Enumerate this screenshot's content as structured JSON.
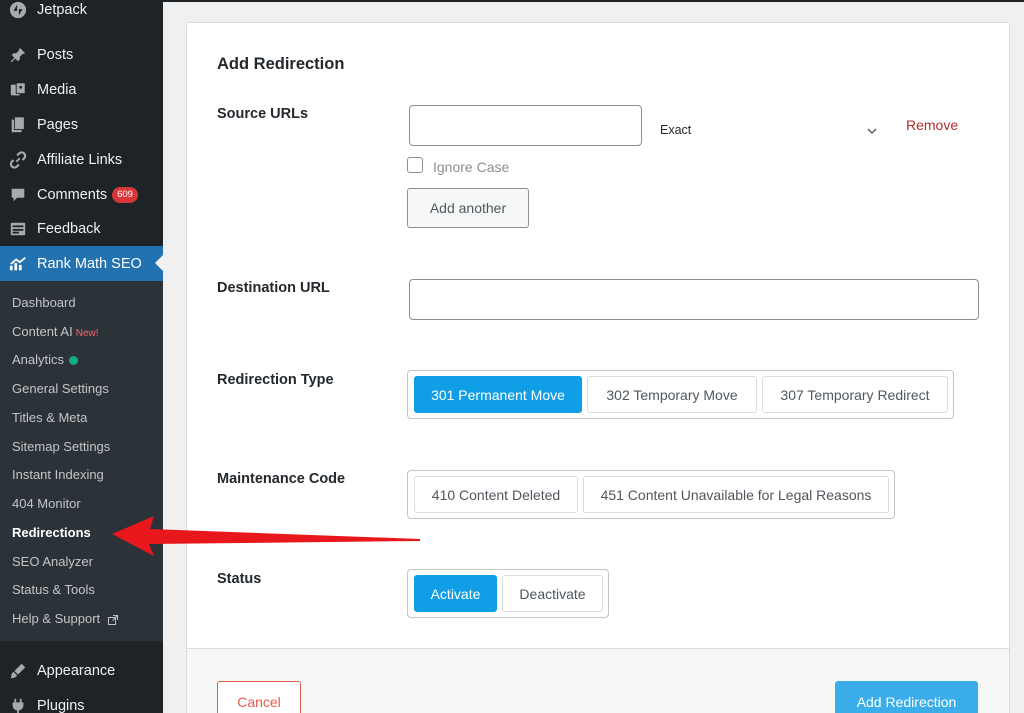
{
  "sidebar": {
    "menu": [
      {
        "label": "Jetpack",
        "icon": "jetpack-icon"
      },
      {
        "label": "Posts",
        "icon": "pin-icon"
      },
      {
        "label": "Media",
        "icon": "media-icon"
      },
      {
        "label": "Pages",
        "icon": "pages-icon"
      },
      {
        "label": "Affiliate Links",
        "icon": "link-icon"
      },
      {
        "label": "Comments",
        "icon": "comment-icon",
        "badge": "609"
      },
      {
        "label": "Feedback",
        "icon": "feedback-icon"
      },
      {
        "label": "Rank Math SEO",
        "icon": "rank-math-icon"
      }
    ],
    "submenu": [
      {
        "label": "Dashboard"
      },
      {
        "label": "Content AI",
        "tag": "New!"
      },
      {
        "label": "Analytics"
      },
      {
        "label": "General Settings"
      },
      {
        "label": "Titles & Meta"
      },
      {
        "label": "Sitemap Settings"
      },
      {
        "label": "Instant Indexing"
      },
      {
        "label": "404 Monitor"
      },
      {
        "label": "Redirections"
      },
      {
        "label": "SEO Analyzer"
      },
      {
        "label": "Status & Tools"
      },
      {
        "label": "Help & Support"
      }
    ],
    "bottom_menu": [
      {
        "label": "Appearance",
        "icon": "brush-icon"
      },
      {
        "label": "Plugins",
        "icon": "plugin-icon"
      }
    ]
  },
  "form": {
    "title": "Add Redirection",
    "source_label": "Source URLs",
    "source_value": "",
    "match_type": "Exact",
    "remove_label": "Remove",
    "ignore_case_label": "Ignore Case",
    "add_another_label": "Add another",
    "destination_label": "Destination URL",
    "destination_value": "",
    "redirection_type_label": "Redirection Type",
    "redirection_types": [
      "301 Permanent Move",
      "302 Temporary Move",
      "307 Temporary Redirect"
    ],
    "selected_redirection_type": "301 Permanent Move",
    "maintenance_label": "Maintenance Code",
    "maintenance_codes": [
      "410 Content Deleted",
      "451 Content Unavailable for Legal Reasons"
    ],
    "status_label": "Status",
    "status_options": [
      "Activate",
      "Deactivate"
    ],
    "selected_status": "Activate",
    "cancel_label": "Cancel",
    "submit_label": "Add Redirection"
  },
  "colors": {
    "accent": "#109ee6",
    "sidebar_bg": "#1d2327",
    "active_menu": "#2271b1",
    "danger": "#d63638",
    "annotation_arrow": "#e8171b"
  }
}
